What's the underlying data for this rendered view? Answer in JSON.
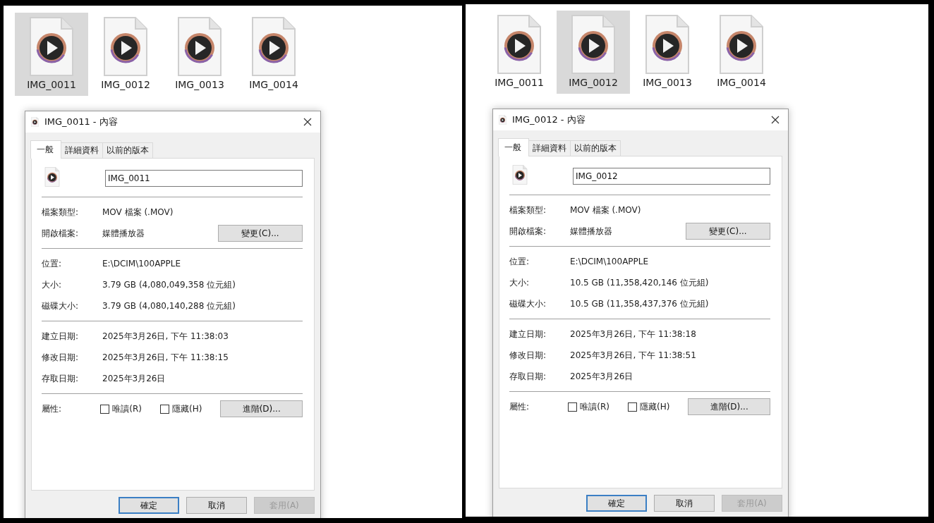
{
  "panels": [
    {
      "files": [
        {
          "name": "IMG_0011",
          "selected": true
        },
        {
          "name": "IMG_0012",
          "selected": false
        },
        {
          "name": "IMG_0013",
          "selected": false
        },
        {
          "name": "IMG_0014",
          "selected": false
        }
      ],
      "dialog": {
        "title": "IMG_0011 - 內容",
        "tabs": [
          {
            "label": "一般",
            "selected": true
          },
          {
            "label": "詳細資料",
            "selected": false
          },
          {
            "label": "以前的版本",
            "selected": false
          }
        ],
        "filename": "IMG_0011",
        "sections": [
          [
            {
              "label": "檔案類型:",
              "value": "MOV 檔案 (.MOV)"
            },
            {
              "label": "開啟檔案:",
              "value": "媒體播放器",
              "button": "變更(C)..."
            }
          ],
          [
            {
              "label": "位置:",
              "value": "E:\\DCIM\\100APPLE"
            },
            {
              "label": "大小:",
              "value": "3.79 GB (4,080,049,358 位元組)"
            },
            {
              "label": "磁碟大小:",
              "value": "3.79 GB (4,080,140,288 位元組)"
            }
          ],
          [
            {
              "label": "建立日期:",
              "value": "2025年3月26日, 下午 11:38:03"
            },
            {
              "label": "修改日期:",
              "value": "2025年3月26日, 下午 11:38:15"
            },
            {
              "label": "存取日期:",
              "value": "2025年3月26日"
            }
          ]
        ],
        "attributes": {
          "label": "屬性:",
          "checkboxes": [
            {
              "label": "唯讀(R)",
              "checked": false
            },
            {
              "label": "隱藏(H)",
              "checked": false
            }
          ],
          "button": "進階(D)..."
        },
        "buttons": [
          {
            "label": "確定",
            "kind": "default"
          },
          {
            "label": "取消",
            "kind": "normal"
          },
          {
            "label": "套用(A)",
            "kind": "disabled"
          }
        ]
      }
    },
    {
      "files": [
        {
          "name": "IMG_0011",
          "selected": false
        },
        {
          "name": "IMG_0012",
          "selected": true
        },
        {
          "name": "IMG_0013",
          "selected": false
        },
        {
          "name": "IMG_0014",
          "selected": false
        }
      ],
      "dialog": {
        "title": "IMG_0012 - 內容",
        "tabs": [
          {
            "label": "一般",
            "selected": true
          },
          {
            "label": "詳細資料",
            "selected": false
          },
          {
            "label": "以前的版本",
            "selected": false
          }
        ],
        "filename": "IMG_0012",
        "sections": [
          [
            {
              "label": "檔案類型:",
              "value": "MOV 檔案 (.MOV)"
            },
            {
              "label": "開啟檔案:",
              "value": "媒體播放器",
              "button": "變更(C)..."
            }
          ],
          [
            {
              "label": "位置:",
              "value": "E:\\DCIM\\100APPLE"
            },
            {
              "label": "大小:",
              "value": "10.5 GB (11,358,420,146 位元組)"
            },
            {
              "label": "磁碟大小:",
              "value": "10.5 GB (11,358,437,376 位元組)"
            }
          ],
          [
            {
              "label": "建立日期:",
              "value": "2025年3月26日, 下午 11:38:18"
            },
            {
              "label": "修改日期:",
              "value": "2025年3月26日, 下午 11:38:51"
            },
            {
              "label": "存取日期:",
              "value": "2025年3月26日"
            }
          ]
        ],
        "attributes": {
          "label": "屬性:",
          "checkboxes": [
            {
              "label": "唯讀(R)",
              "checked": false
            },
            {
              "label": "隱藏(H)",
              "checked": false
            }
          ],
          "button": "進階(D)..."
        },
        "buttons": [
          {
            "label": "確定",
            "kind": "default"
          },
          {
            "label": "取消",
            "kind": "normal"
          },
          {
            "label": "套用(A)",
            "kind": "disabled"
          }
        ]
      }
    }
  ]
}
